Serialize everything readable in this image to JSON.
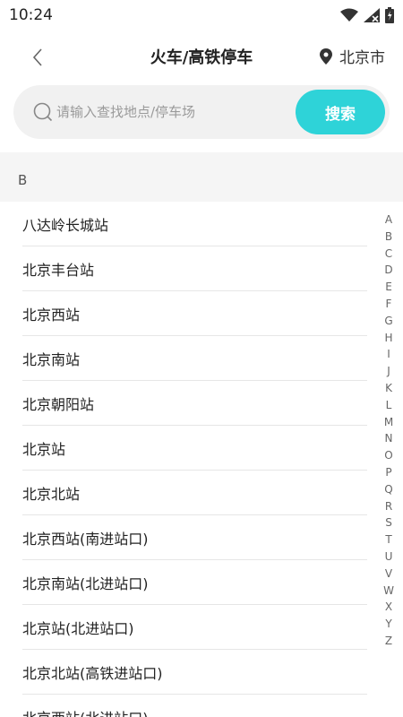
{
  "status_bar": {
    "time": "10:24"
  },
  "header": {
    "title": "火车/高铁停车",
    "city": "北京市"
  },
  "search": {
    "placeholder": "请输入查找地点/停车场",
    "value": "",
    "button_label": "搜索"
  },
  "section": {
    "letter": "B"
  },
  "stations": [
    "八达岭长城站",
    "北京丰台站",
    "北京西站",
    "北京南站",
    "北京朝阳站",
    "北京站",
    "北京北站",
    "北京西站(南进站口)",
    "北京南站(北进站口)",
    "北京站(北进站口)",
    "北京北站(高铁进站口)",
    "北京西站(北进站口)"
  ],
  "index_letters": [
    "A",
    "B",
    "C",
    "D",
    "E",
    "F",
    "G",
    "H",
    "I",
    "J",
    "K",
    "L",
    "M",
    "N",
    "O",
    "P",
    "Q",
    "R",
    "S",
    "T",
    "U",
    "V",
    "W",
    "X",
    "Y",
    "Z"
  ],
  "colors": {
    "accent": "#2ed3d8",
    "search_bg": "#f1f1f1",
    "list_bg": "#f5f5f5"
  }
}
